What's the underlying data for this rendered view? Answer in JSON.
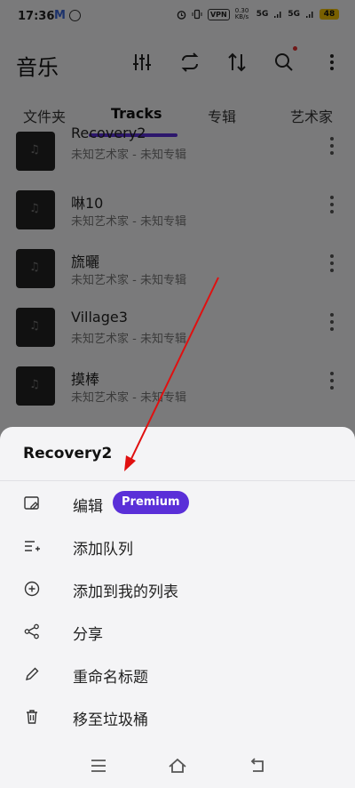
{
  "statusbar": {
    "time": "17:36",
    "m_logo": "M",
    "vpn": "VPN",
    "net_speed": "0.30 KB/s",
    "sig1": "5G",
    "sig2": "5G",
    "battery": "48"
  },
  "app": {
    "title": "音乐"
  },
  "tabs": [
    {
      "label": "文件夹"
    },
    {
      "label": "Tracks"
    },
    {
      "label": "专辑"
    },
    {
      "label": "艺术家"
    }
  ],
  "tracks": [
    {
      "title": "Recovery2",
      "subtitle": "未知艺术家 - 未知专辑"
    },
    {
      "title": "啉10",
      "subtitle": "未知艺术家 - 未知专辑"
    },
    {
      "title": "旒曬",
      "subtitle": "未知艺术家 - 未知专辑"
    },
    {
      "title": "Village3",
      "subtitle": "未知艺术家 - 未知专辑"
    },
    {
      "title": "摸棒",
      "subtitle": "未知艺术家 - 未知专辑"
    }
  ],
  "sheet": {
    "title": "Recovery2",
    "premium_badge": "Premium",
    "items": [
      {
        "label": "编辑",
        "icon": "edit-card-icon"
      },
      {
        "label": "添加队列",
        "icon": "queue-add-icon"
      },
      {
        "label": "添加到我的列表",
        "icon": "plus-circle-icon"
      },
      {
        "label": "分享",
        "icon": "share-icon"
      },
      {
        "label": "重命名标题",
        "icon": "pencil-icon"
      },
      {
        "label": "移至垃圾桶",
        "icon": "trash-icon"
      }
    ]
  },
  "colors": {
    "accent": "#5a2fd8",
    "annotation_arrow": "#e01010"
  }
}
